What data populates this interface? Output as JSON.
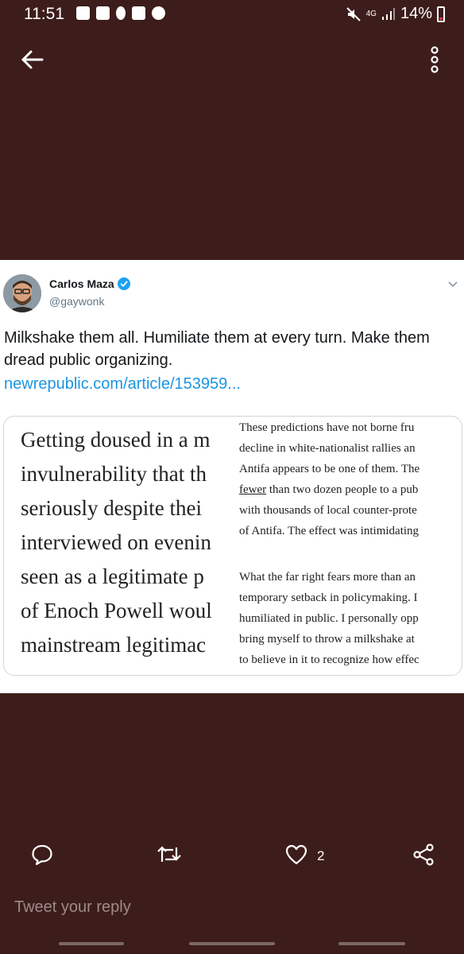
{
  "status_bar": {
    "time": "11:51",
    "network": "4G",
    "battery": "14%"
  },
  "header": {
    "back_icon": "arrow-left-icon",
    "more_icon": "more-vertical-icon"
  },
  "tweet": {
    "author_name": "Carlos Maza",
    "handle": "@gaywonk",
    "verified": true,
    "text": "Milkshake them all. Humiliate them at every turn. Make them dread public organizing.",
    "link": "newrepublic.com/article/153959...",
    "preview": {
      "left_lines": [
        "Getting doused in a m",
        "invulnerability that th",
        "seriously despite thei",
        "interviewed on evenin",
        "seen as a legitimate p",
        "of Enoch Powell woul",
        "mainstream legitimac"
      ],
      "right_lines": [
        "These predictions have not borne fru",
        "decline in white-nationalist rallies an",
        "Antifa appears to be one of them. The",
        "fewer",
        "than two dozen people to a pub",
        "with thousands of local counter-prote",
        "of Antifa. The effect was intimidating",
        "What the far right fears more than an",
        "temporary setback in policymaking. I",
        "humiliated in public. I personally opp",
        "bring myself to throw a milkshake at",
        "to believe in it to recognize how effec"
      ]
    }
  },
  "actions": {
    "reply_icon": "comment-icon",
    "retweet_icon": "retweet-icon",
    "like_icon": "heart-icon",
    "like_count": "2",
    "share_icon": "share-icon"
  },
  "reply_placeholder": "Tweet your reply",
  "colors": {
    "background": "#3d1d1b",
    "link": "#1b95e0",
    "verified": "#1da1f2"
  }
}
